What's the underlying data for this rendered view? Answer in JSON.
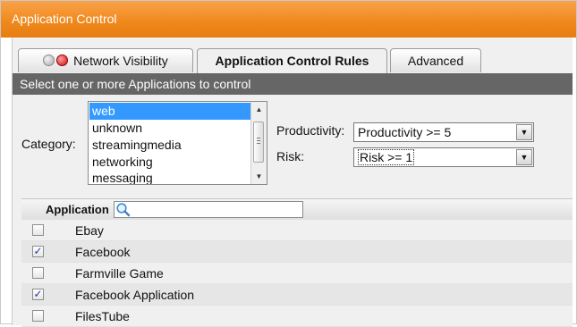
{
  "window": {
    "title": "Application Control"
  },
  "tabs": [
    {
      "label": "Network Visibility",
      "active": false,
      "status_icons": [
        "grey-dot-icon",
        "red-dot-icon"
      ]
    },
    {
      "label": "Application Control Rules",
      "active": true
    },
    {
      "label": "Advanced",
      "active": false
    }
  ],
  "instruction": "Select one or more Applications to control",
  "category": {
    "label": "Category:",
    "items": [
      "web",
      "unknown",
      "streamingmedia",
      "networking",
      "messaging"
    ],
    "selected": "web"
  },
  "productivity": {
    "label": "Productivity:",
    "value": "Productivity >= 5"
  },
  "risk": {
    "label": "Risk:",
    "value": "Risk >= 1"
  },
  "grid": {
    "column_header": "Application",
    "search_placeholder": "",
    "rows": [
      {
        "name": "Ebay",
        "checked": false
      },
      {
        "name": "Facebook",
        "checked": true
      },
      {
        "name": "Farmville Game",
        "checked": false
      },
      {
        "name": "Facebook Application",
        "checked": true
      },
      {
        "name": "FilesTube",
        "checked": false
      }
    ]
  },
  "colors": {
    "titlebar": "#f08a1e",
    "instruction_bar": "#666666",
    "selection": "#3399ff",
    "check": "#1a3da6"
  }
}
